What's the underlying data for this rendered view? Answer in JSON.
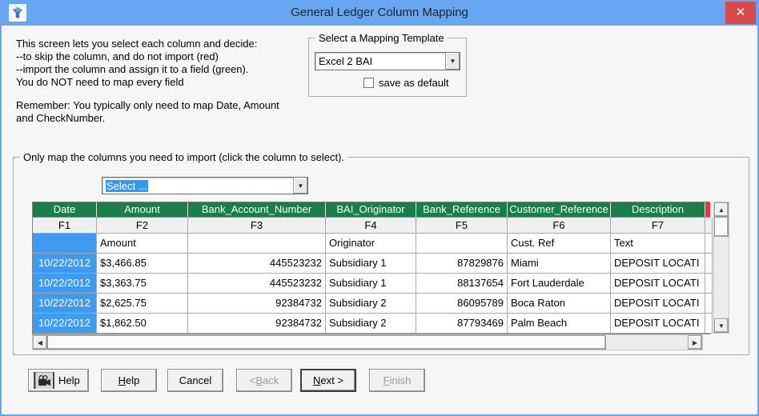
{
  "titlebar": {
    "title": "General Ledger Column Mapping",
    "close_glyph": "✕"
  },
  "intro": {
    "lines": [
      "This screen lets you select each column and decide:",
      "--to skip the column, and do not import (red)",
      "--import the column and assign it to a field (green).",
      "You do NOT need to map every field"
    ],
    "remember_lines": [
      "Remember:  You typically only need to map Date, Amount",
      "and CheckNumber."
    ]
  },
  "template_group": {
    "label": "Select a Mapping Template",
    "combo_value": "Excel 2 BAI",
    "save_default_label": "save as default",
    "save_default_checked": false
  },
  "mapping_group": {
    "label": "Only map the columns you need to import (click the column to select).",
    "column_select_value": "Select ..."
  },
  "grid": {
    "headers": [
      "Date",
      "Amount",
      "Bank_Account_Number",
      "BAI_Originator",
      "Bank_Reference",
      "Customer_Reference",
      "Description"
    ],
    "field_codes": [
      "F1",
      "F2",
      "F3",
      "F4",
      "F5",
      "F6",
      "F7"
    ],
    "field_labels": [
      "",
      "Amount",
      "",
      "Originator",
      "",
      "Cust. Ref",
      "Text"
    ],
    "rows": [
      [
        "10/22/2012",
        "$3,466.85",
        "445523232",
        "Subsidiary 1",
        "87829876",
        "Miami",
        "DEPOSIT LOCATI"
      ],
      [
        "10/22/2012",
        "$3,363.75",
        "445523232",
        "Subsidiary 1",
        "88137654",
        "Fort Lauderdale",
        "DEPOSIT LOCATI"
      ],
      [
        "10/22/2012",
        "$2,625.75",
        "92384732",
        "Subsidiary 2",
        "86095789",
        "Boca Raton",
        "DEPOSIT LOCATI"
      ],
      [
        "10/22/2012",
        "$1,862.50",
        "92384732",
        "Subsidiary 2",
        "87793469",
        "Palm Beach",
        "DEPOSIT LOCATI"
      ]
    ],
    "selected_column": "Date"
  },
  "buttons": {
    "help_video": "Help",
    "help": "Help",
    "cancel": "Cancel",
    "back": "< Back",
    "next": "Next >",
    "finish": "Finish"
  },
  "icons": {
    "dropdown": "▼",
    "scroll_up": "▲",
    "scroll_down": "▼",
    "scroll_left": "◀",
    "scroll_right": "▶"
  },
  "colors": {
    "titlebar": "#69a6f2",
    "close": "#d8494a",
    "header_green": "#1a7e4b",
    "selected_blue": "#3f9bf2",
    "skip_red": "#e23b3b"
  }
}
